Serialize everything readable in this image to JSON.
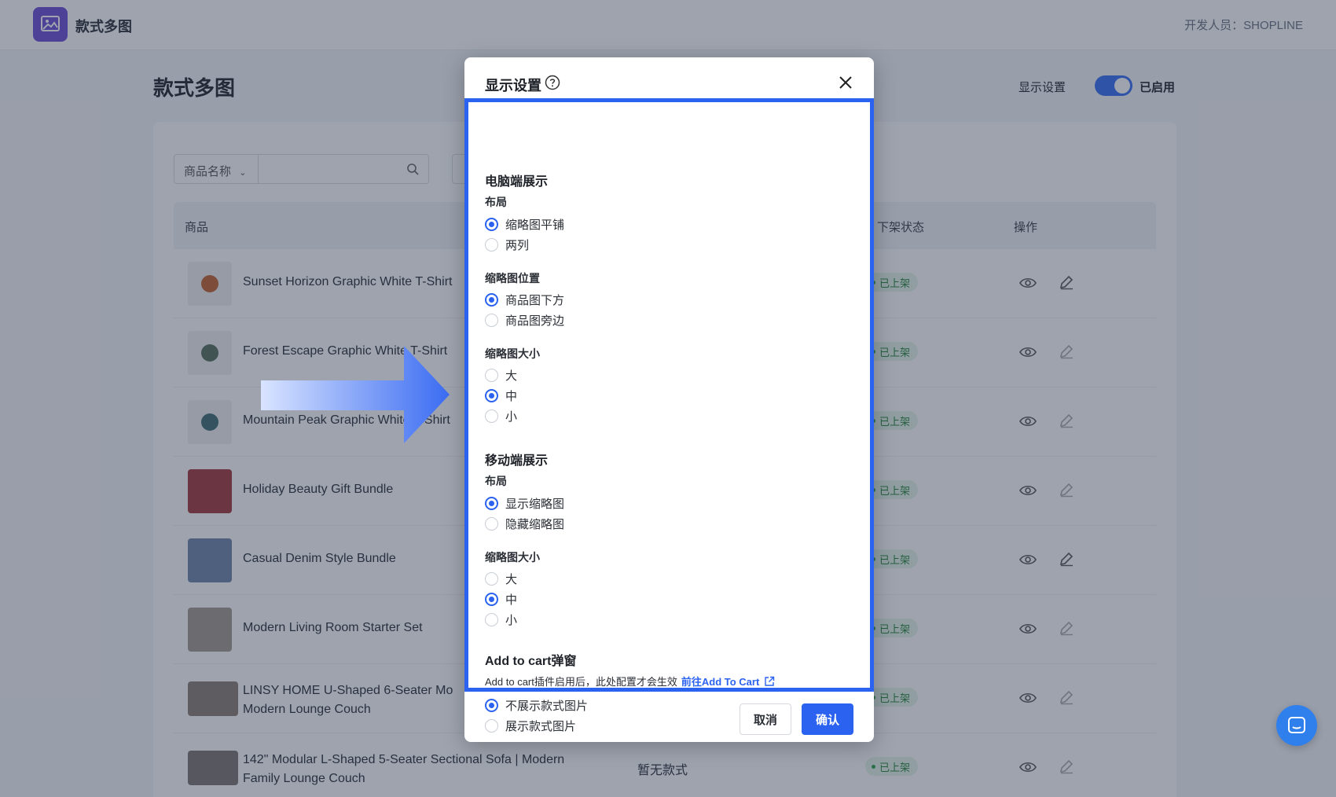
{
  "app": {
    "name": "款式多图",
    "developer": "开发人员：SHOPLINE"
  },
  "page": {
    "title": "款式多图",
    "display_settings": "显示设置",
    "enabled_label": "已启用",
    "filter": {
      "select_label": "商品名称"
    },
    "columns": {
      "product": "商品",
      "status": "下架状态",
      "actions": "操作"
    },
    "rows": [
      {
        "title": "Sunset Horizon Graphic White T-Shirt",
        "status": "已上架"
      },
      {
        "title": "Forest Escape Graphic White T-Shirt",
        "status": "已上架"
      },
      {
        "title": "Mountain Peak Graphic White T-Shirt",
        "status": "已上架"
      },
      {
        "title": "Holiday Beauty Gift Bundle",
        "status": "已上架"
      },
      {
        "title": "Casual Denim Style Bundle",
        "status": "已上架"
      },
      {
        "title": "Modern Living Room Starter Set",
        "status": "已上架"
      },
      {
        "title_line1": "LINSY HOME U-Shaped 6-Seater Mo",
        "title_line2": "Modern Lounge Couch",
        "status": "已上架"
      },
      {
        "title_line1": "142\" Modular L-Shaped 5-Seater Sectional Sofa | Modern",
        "title_line2": "Family Lounge Couch",
        "variant": "暂无款式",
        "status": "已上架"
      }
    ]
  },
  "modal": {
    "title": "显示设置",
    "desktop": {
      "title": "电脑端展示",
      "layout_label": "布局",
      "layout_options": [
        "缩略图平铺",
        "两列"
      ],
      "position_label": "缩略图位置",
      "position_options": [
        "商品图下方",
        "商品图旁边"
      ],
      "size_label": "缩略图大小",
      "size_options": [
        "大",
        "中",
        "小"
      ]
    },
    "mobile": {
      "title": "移动端展示",
      "layout_label": "布局",
      "layout_options": [
        "显示缩略图",
        "隐藏缩略图"
      ],
      "size_label": "缩略图大小",
      "size_options": [
        "大",
        "中",
        "小"
      ]
    },
    "cart": {
      "title": "Add to cart弹窗",
      "note": "Add to cart插件启用后，此处配置才会生效",
      "link": "前往Add To Cart",
      "options": [
        "不展示款式图片",
        "展示款式图片"
      ]
    },
    "cancel": "取消",
    "confirm": "确认"
  },
  "colors": {
    "accent": "#2c62f0",
    "toggle": "#356df3",
    "badge_bg": "#e6f6ea",
    "badge_text": "#27853a"
  },
  "icons": [
    "image-icon",
    "help-icon",
    "close-icon",
    "search-icon",
    "eye-icon",
    "edit-icon",
    "external-link-icon",
    "chat-icon",
    "arrow-right-icon"
  ]
}
